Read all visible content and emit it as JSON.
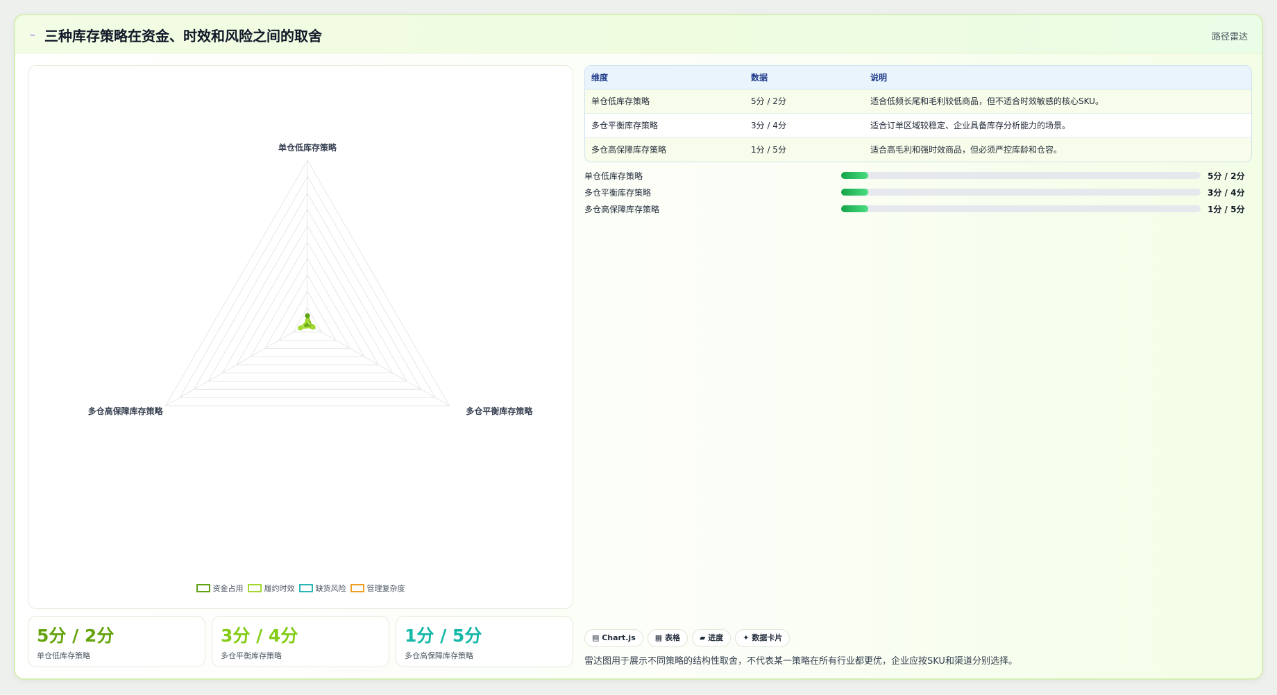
{
  "header": {
    "flag_icon": "~",
    "title": "三种库存策略在资金、时效和风险之间的取舍",
    "tag": "路径雷达"
  },
  "chart_data": {
    "type": "radar",
    "axes": [
      "单仓低库存策略",
      "多仓平衡库存策略",
      "多仓高保障库存策略"
    ],
    "range": [
      0,
      100
    ],
    "grid_levels": 10,
    "series": [
      {
        "name": "资金占用",
        "color": "#5fa313",
        "values": [
          5,
          3,
          1
        ]
      },
      {
        "name": "履约时效",
        "color": "#a3d92f",
        "values": [
          2,
          4,
          5
        ]
      },
      {
        "name": "缺货风险",
        "color": "#2bb5b5",
        "values": [
          null,
          null,
          null
        ]
      },
      {
        "name": "管理复杂度",
        "color": "#f0a020",
        "values": [
          null,
          null,
          null
        ]
      }
    ]
  },
  "stats": [
    {
      "value": "5分 / 2分",
      "label": "单仓低库存策略",
      "color": "#65a30d"
    },
    {
      "value": "3分 / 4分",
      "label": "多仓平衡库存策略",
      "color": "#84cc16"
    },
    {
      "value": "1分 / 5分",
      "label": "多仓高保障库存策略",
      "color": "#14b8a6"
    }
  ],
  "table": {
    "headers": [
      "维度",
      "数据",
      "说明"
    ],
    "rows": [
      [
        "单仓低库存策略",
        "5分 / 2分",
        "适合低频长尾和毛利较低商品，但不适合时效敏感的核心SKU。"
      ],
      [
        "多仓平衡库存策略",
        "3分 / 4分",
        "适合订单区域较稳定、企业具备库存分析能力的场景。"
      ],
      [
        "多仓高保障库存策略",
        "1分 / 5分",
        "适合高毛利和强时效商品，但必须严控库龄和仓容。"
      ]
    ]
  },
  "progress": [
    {
      "label": "单仓低库存策略",
      "value": "5分 / 2分",
      "fraction": 0.075
    },
    {
      "label": "多仓平衡库存策略",
      "value": "3分 / 4分",
      "fraction": 0.075
    },
    {
      "label": "多仓高保障库存策略",
      "value": "1分 / 5分",
      "fraction": 0.075
    }
  ],
  "chips": [
    {
      "icon": "bar-chart-icon",
      "glyph": "▤",
      "label": "Chart.js"
    },
    {
      "icon": "table-icon",
      "glyph": "▦",
      "label": "表格"
    },
    {
      "icon": "progress-icon",
      "glyph": "▰",
      "label": "进度"
    },
    {
      "icon": "sparkle-icon",
      "glyph": "✦",
      "label": "数据卡片"
    }
  ],
  "footnote": "雷达图用于展示不同策略的结构性取舍，不代表某一策略在所有行业都更优，企业应按SKU和渠道分别选择。"
}
